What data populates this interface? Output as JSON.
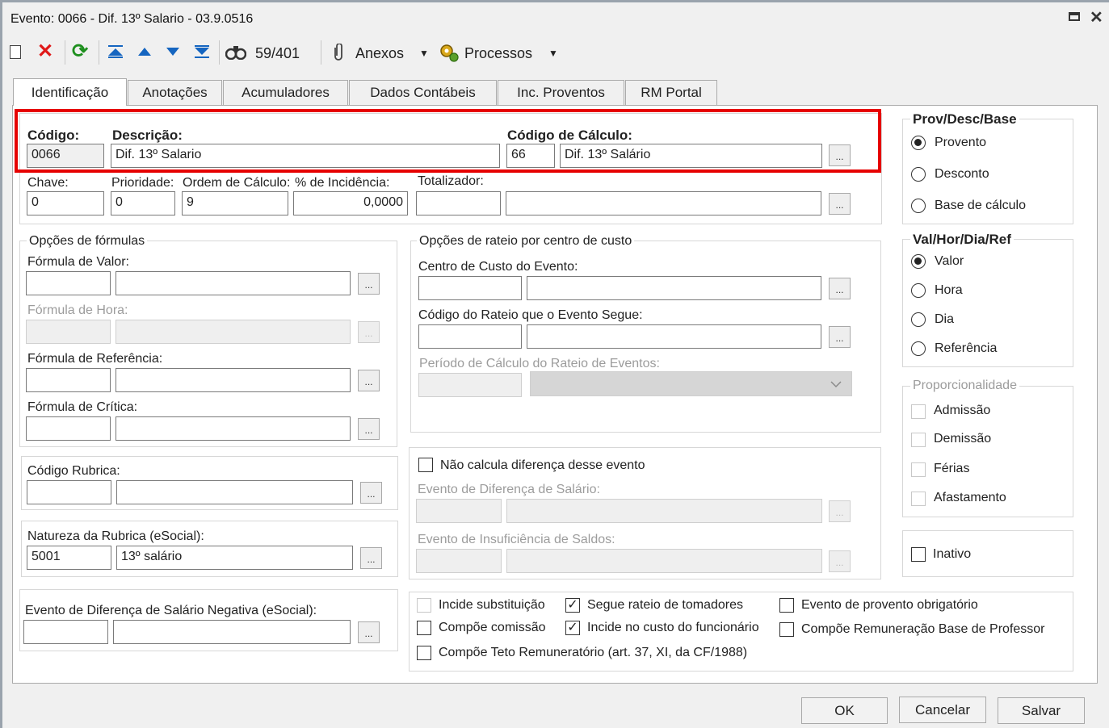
{
  "window": {
    "title": "Evento: 0066 - Dif. 13º Salario - 03.9.0516",
    "maximize_icon": "maximize-icon",
    "close_icon": "close-icon"
  },
  "toolbar": {
    "record_counter": "59/401",
    "anexos": "Anexos",
    "processos": "Processos",
    "dropdown_glyph": "▼",
    "icons": [
      "new-document-icon",
      "delete-icon",
      "refresh-icon",
      "first-record-icon",
      "previous-record-icon",
      "next-record-icon",
      "last-record-icon",
      "search-binoculars-icon",
      "attachment-icon",
      "processes-gear-icon"
    ]
  },
  "tabs": [
    "Identificação",
    "Anotações",
    "Acumuladores",
    "Dados Contábeis",
    "Inc. Proventos",
    "RM Portal"
  ],
  "ident": {
    "codigo_label": "Código:",
    "codigo": "0066",
    "descricao_label": "Descrição:",
    "descricao": "Dif. 13º Salario",
    "codcalc_label": "Código de Cálculo:",
    "codcalc": "66",
    "codcalc_desc": "Dif. 13º Salário",
    "chave_label": "Chave:",
    "chave": "0",
    "prioridade_label": "Prioridade:",
    "prioridade": "0",
    "ordem_label": "Ordem de Cálculo:",
    "ordem": "9",
    "incidencia_label": "% de Incidência:",
    "incidencia": "0,0000",
    "totalizador_label": "Totalizador:",
    "totalizador": "",
    "totalizador_desc": ""
  },
  "formulas": {
    "title": "Opções de fórmulas",
    "valor_label": "Fórmula de Valor:",
    "hora_label": "Fórmula de Hora:",
    "referencia_label": "Fórmula de Referência:",
    "critica_label": "Fórmula de Crítica:"
  },
  "rubrica": {
    "label": "Código Rubrica:",
    "code": "",
    "desc": ""
  },
  "natureza": {
    "label": "Natureza da Rubrica (eSocial):",
    "code": "5001",
    "desc": "13º salário"
  },
  "difneg": {
    "label": "Evento de Diferença de Salário Negativa (eSocial):",
    "code": "",
    "desc": ""
  },
  "rateio": {
    "title": "Opções de rateio por centro de custo",
    "centro_label": "Centro de Custo do Evento:",
    "codigo_label": "Código do Rateio que o Evento Segue:",
    "periodo_label": "Período de Cálculo do Rateio de Eventos:",
    "select_icon": "chevron-down-icon"
  },
  "difsal": {
    "nao_calcula": "Não calcula diferença desse evento",
    "evento_dif_label": "Evento de Diferença de Salário:",
    "evento_insuf_label": "Evento de Insuficiência de Saldos:"
  },
  "checks": {
    "incide_subst": "Incide substituição",
    "compoe_comissao": "Compõe comissão",
    "compoe_teto": "Compõe Teto Remuneratório (art. 37, XI, da CF/1988)",
    "segue_rateio": "Segue rateio de tomadores",
    "incide_custo": "Incide no custo do funcionário",
    "evento_obrig": "Evento de provento obrigatório",
    "compoe_remun": "Compõe Remuneração Base de Professor",
    "check_mark": "✓"
  },
  "provdesc": {
    "title": "Prov/Desc/Base",
    "options": [
      "Provento",
      "Desconto",
      "Base de cálculo"
    ],
    "selected": "Provento"
  },
  "valhor": {
    "title": "Val/Hor/Dia/Ref",
    "options": [
      "Valor",
      "Hora",
      "Dia",
      "Referência"
    ],
    "selected": "Valor"
  },
  "proporc": {
    "title": "Proporcionalidade",
    "options": [
      "Admissão",
      "Demissão",
      "Férias",
      "Afastamento"
    ]
  },
  "inativo": {
    "label": "Inativo"
  },
  "footer": {
    "ok": "OK",
    "cancel": "Cancelar",
    "save": "Salvar"
  },
  "ellipsis": "...",
  "colors": {
    "highlight": "#e60000",
    "window_bg": "#f0f0f0",
    "content_bg": "#ffffff"
  }
}
